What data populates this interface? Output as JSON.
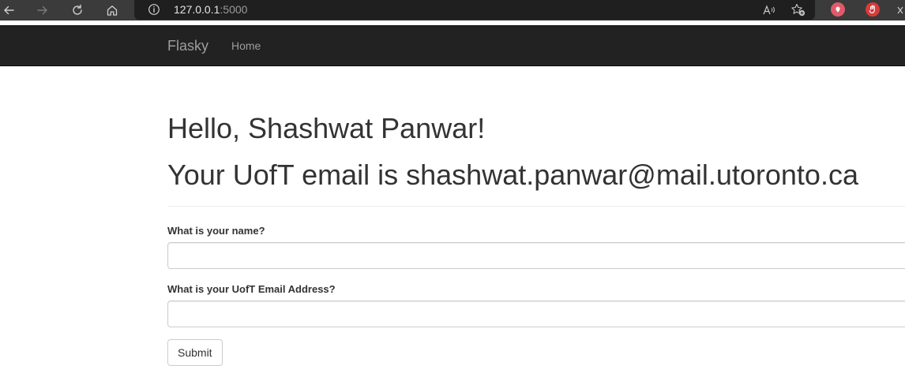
{
  "browser": {
    "url_host": "127.0.0.1",
    "url_port": ":5000",
    "icons": {
      "back": "arrow-left-icon",
      "forward": "arrow-right-icon",
      "reload": "reload-icon",
      "home": "home-icon",
      "site_info": "info-icon",
      "read_aloud": "read-aloud-icon",
      "favorites": "add-favorite-icon",
      "extension_1": "extension-badge-icon",
      "extension_2": "stop-hand-icon"
    },
    "colors": {
      "toolbar": "#3b3b3b",
      "address_bar": "#1f1f1f",
      "ext_red": "#d83b3b"
    }
  },
  "navbar": {
    "brand": "Flasky",
    "links": [
      "Home"
    ],
    "colors": {
      "background": "#222222",
      "text": "#9d9d9d"
    }
  },
  "page": {
    "greeting": "Hello, Shashwat Panwar!",
    "email_line": "Your UofT email is shashwat.panwar@mail.utoronto.ca"
  },
  "form": {
    "name_label": "What is your name?",
    "name_value": "",
    "email_label": "What is your UofT Email Address?",
    "email_value": "",
    "submit_label": "Submit"
  }
}
